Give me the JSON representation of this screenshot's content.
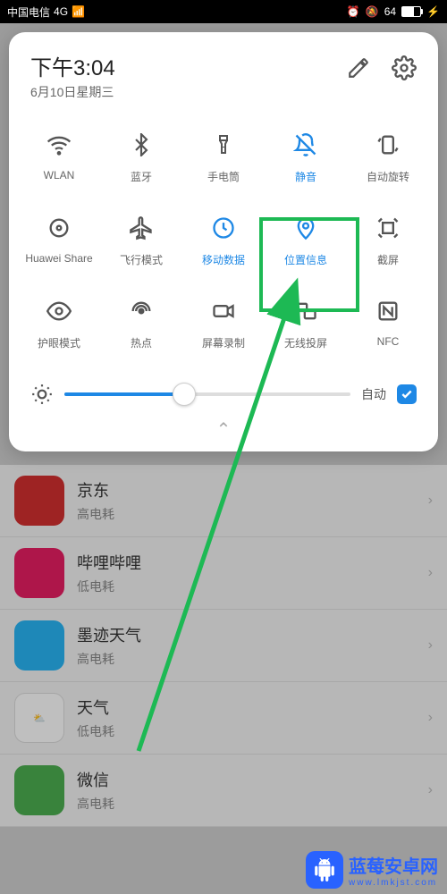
{
  "status": {
    "carrier": "中国电信",
    "network": "4G",
    "battery_pct": "64"
  },
  "panel": {
    "time": "下午3:04",
    "date": "6月10日星期三",
    "brightness": {
      "auto_label": "自动"
    }
  },
  "tiles": [
    {
      "label": "WLAN",
      "icon": "wifi",
      "active": false
    },
    {
      "label": "蓝牙",
      "icon": "bluetooth",
      "active": false
    },
    {
      "label": "手电筒",
      "icon": "flashlight",
      "active": false
    },
    {
      "label": "静音",
      "icon": "mute",
      "active": true
    },
    {
      "label": "自动旋转",
      "icon": "rotate",
      "active": false
    },
    {
      "label": "Huawei Share",
      "icon": "share",
      "active": false
    },
    {
      "label": "飞行模式",
      "icon": "airplane",
      "active": false
    },
    {
      "label": "移动数据",
      "icon": "data",
      "active": true
    },
    {
      "label": "位置信息",
      "icon": "location",
      "active": true
    },
    {
      "label": "截屏",
      "icon": "screenshot",
      "active": false
    },
    {
      "label": "护眼模式",
      "icon": "eye",
      "active": false
    },
    {
      "label": "热点",
      "icon": "hotspot",
      "active": false
    },
    {
      "label": "屏幕录制",
      "icon": "record",
      "active": false
    },
    {
      "label": "无线投屏",
      "icon": "cast",
      "active": false
    },
    {
      "label": "NFC",
      "icon": "nfc",
      "active": false
    }
  ],
  "bg_apps": [
    {
      "name": "京东",
      "sub": "高电耗",
      "color": "#d32f2f",
      "tag": "JD"
    },
    {
      "name": "哔哩哔哩",
      "sub": "低电耗",
      "color": "#e91e63",
      "tag": "bili"
    },
    {
      "name": "墨迹天气",
      "sub": "高电耗",
      "color": "#29b6f6",
      "tag": "☁"
    },
    {
      "name": "天气",
      "sub": "低电耗",
      "color": "#4fc3f7",
      "tag": "☀"
    },
    {
      "name": "微信",
      "sub": "高电耗",
      "color": "#4caf50",
      "tag": "✉"
    }
  ],
  "watermark": {
    "brand": "蓝莓安卓网",
    "url": "www.lmkjst.com"
  }
}
